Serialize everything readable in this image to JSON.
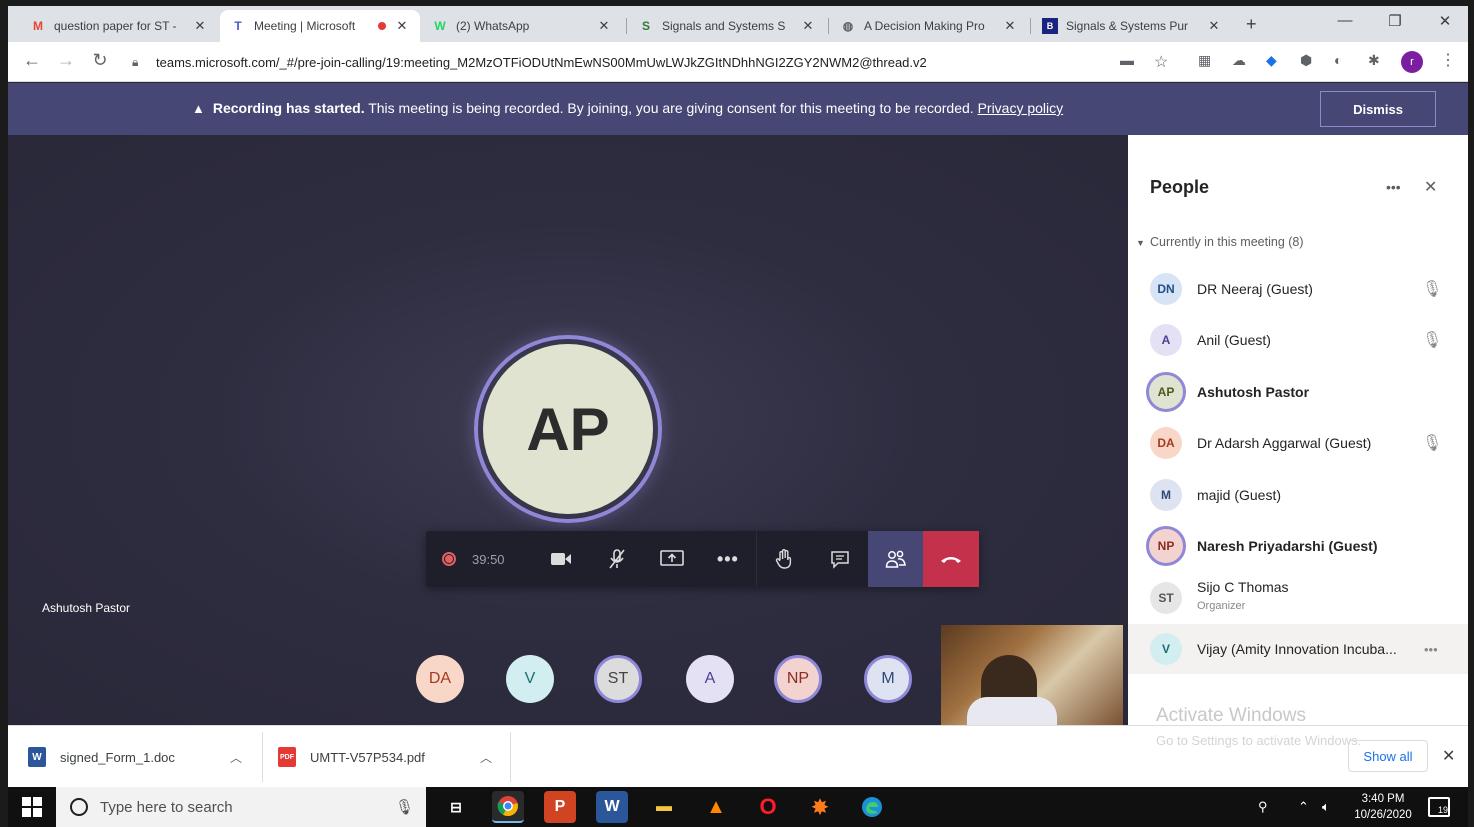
{
  "browser": {
    "tabs": [
      {
        "title": "question paper for ST -",
        "favicon": "gmail-icon",
        "color": "#ea4335",
        "glyph": "M"
      },
      {
        "title": "Meeting | Microsoft",
        "favicon": "teams-icon",
        "color": "#5059c9",
        "glyph": "T",
        "recording": true
      },
      {
        "title": "(2) WhatsApp",
        "favicon": "whatsapp-icon",
        "color": "#25d366",
        "glyph": "W"
      },
      {
        "title": "Signals and Systems S",
        "favicon": "signals-icon",
        "color": "#2e7d32",
        "glyph": "S"
      },
      {
        "title": "A Decision Making Pro",
        "favicon": "globe-icon",
        "color": "#5f6368",
        "glyph": "◍"
      },
      {
        "title": "Signals & Systems Pur",
        "favicon": "book-icon",
        "color": "#1a237e",
        "glyph": "B"
      }
    ],
    "url": "teams.microsoft.com/_#/pre-join-calling/19:meeting_M2MzOTFiODUtNmEwNS00MmUwLWJkZGItNDhhNGI2ZGY2NWM2@thread.v2",
    "profile_initial": "r"
  },
  "banner": {
    "bold": "Recording has started.",
    "text": " This meeting is being recorded. By joining, you are giving consent for this meeting to be recorded. ",
    "link": "Privacy policy",
    "dismiss": "Dismiss"
  },
  "stage": {
    "main_initials": "AP",
    "timer": "39:50",
    "presenter_name": "Ashutosh Pastor",
    "roster": [
      {
        "initials": "DA",
        "bg": "#f8d7c8",
        "fg": "#a33c1f",
        "ring": false
      },
      {
        "initials": "V",
        "bg": "#d3eef0",
        "fg": "#1c6e75",
        "ring": false
      },
      {
        "initials": "ST",
        "bg": "#dcdcdc",
        "fg": "#444444",
        "ring": true
      },
      {
        "initials": "A",
        "bg": "#e5e1f5",
        "fg": "#4f3e8f",
        "ring": false
      },
      {
        "initials": "NP",
        "bg": "#f3d3d0",
        "fg": "#8c2c22",
        "ring": true
      },
      {
        "initials": "M",
        "bg": "#dde3f0",
        "fg": "#2e4a7a",
        "ring": true
      }
    ]
  },
  "panel": {
    "title": "People",
    "section": "Currently in this meeting  (8)",
    "people": [
      {
        "initials": "DN",
        "name": "DR Neeraj (Guest)",
        "bg": "#d6e4f5",
        "fg": "#20508a",
        "muted": true
      },
      {
        "initials": "A",
        "name": "Anil (Guest)",
        "bg": "#e5e1f5",
        "fg": "#4f3e8f",
        "muted": true
      },
      {
        "initials": "AP",
        "name": "Ashutosh Pastor",
        "bg": "#dfe3d0",
        "fg": "#4a5a1e",
        "bold": true,
        "ring": true
      },
      {
        "initials": "DA",
        "name": "Dr Adarsh Aggarwal (Guest)",
        "bg": "#f8d7c8",
        "fg": "#a33c1f",
        "muted": true
      },
      {
        "initials": "M",
        "name": "majid (Guest)",
        "bg": "#dde3f0",
        "fg": "#2e4a7a"
      },
      {
        "initials": "NP",
        "name": "Naresh Priyadarshi (Guest)",
        "bg": "#f3d3d0",
        "fg": "#8c2c22",
        "bold": true,
        "ring": true
      },
      {
        "initials": "ST",
        "name": "Sijo C Thomas",
        "sub": "Organizer",
        "bg": "#e6e6e6",
        "fg": "#555555"
      },
      {
        "initials": "V",
        "name": "Vijay (Amity Innovation Incuba...",
        "bg": "#d3eef0",
        "fg": "#1c6e75",
        "highlight": true,
        "more": true
      }
    ],
    "activate_title": "Activate Windows",
    "activate_sub": "Go to Settings to activate Windows."
  },
  "downloads": {
    "items": [
      {
        "name": "signed_Form_1.doc",
        "icon": "word-doc-icon",
        "color": "#2b579a",
        "glyph": "W"
      },
      {
        "name": "UMTT-V57P534.pdf",
        "icon": "pdf-icon",
        "color": "#e53935",
        "glyph": "PDF"
      }
    ],
    "show_all": "Show all"
  },
  "taskbar": {
    "search_placeholder": "Type here to search",
    "time": "3:40 PM",
    "date": "10/26/2020",
    "notification_count": "19"
  },
  "colors": {
    "teams_purple": "#464775",
    "hangup_red": "#c4314b",
    "ring_purple": "#8f87d8"
  }
}
